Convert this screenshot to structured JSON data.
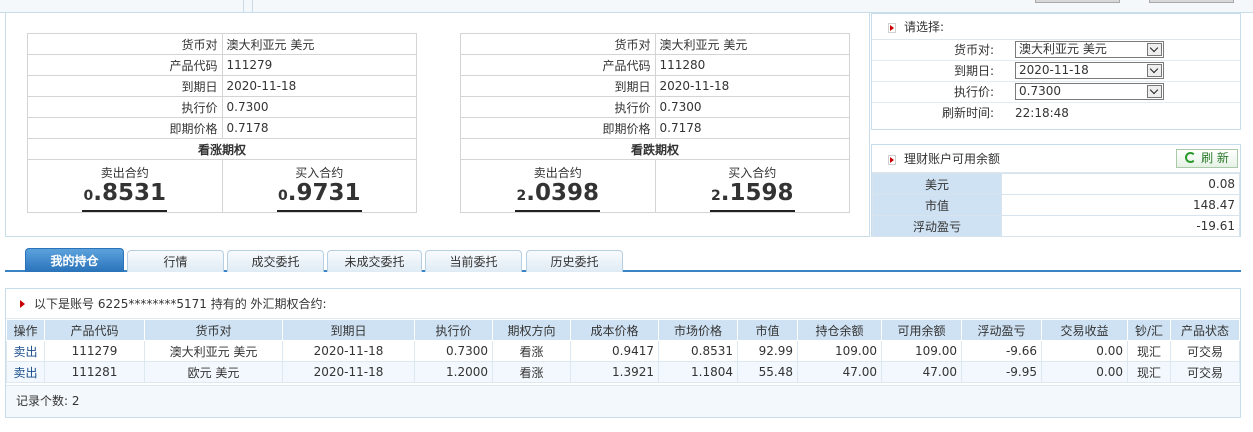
{
  "quotes": [
    {
      "fields": [
        {
          "label": "货币对",
          "value": "澳大利亚元 美元"
        },
        {
          "label": "产品代码",
          "value": "111279"
        },
        {
          "label": "到期日",
          "value": "2020-11-18"
        },
        {
          "label": "执行价",
          "value": "0.7300"
        },
        {
          "label": "即期价格",
          "value": "0.7178"
        }
      ],
      "option_type": "看涨期权",
      "sell_label": "卖出合约",
      "sell_int": "0",
      "sell_dec": ".8531",
      "buy_label": "买入合约",
      "buy_int": "0",
      "buy_dec": ".9731"
    },
    {
      "fields": [
        {
          "label": "货币对",
          "value": "澳大利亚元 美元"
        },
        {
          "label": "产品代码",
          "value": "111280"
        },
        {
          "label": "到期日",
          "value": "2020-11-18"
        },
        {
          "label": "执行价",
          "value": "0.7300"
        },
        {
          "label": "即期价格",
          "value": "0.7178"
        }
      ],
      "option_type": "看跌期权",
      "sell_label": "卖出合约",
      "sell_int": "2",
      "sell_dec": ".0398",
      "buy_label": "买入合约",
      "buy_int": "2",
      "buy_dec": ".1598"
    }
  ],
  "selector": {
    "title": "请选择:",
    "pair_label": "货币对:",
    "pair_value": "澳大利亚元 美元",
    "expiry_label": "到期日:",
    "expiry_value": "2020-11-18",
    "strike_label": "执行价:",
    "strike_value": "0.7300",
    "refresh_label": "刷新时间:",
    "refresh_time": "22:18:48"
  },
  "balance": {
    "title": "理财账户可用余额",
    "refresh_button": "刷 新",
    "rows": [
      {
        "label": "美元",
        "value": "0.08"
      },
      {
        "label": "市值",
        "value": "148.47"
      },
      {
        "label": "浮动盈亏",
        "value": "-19.61"
      }
    ]
  },
  "tabs": [
    "我的持仓",
    "行情",
    "成交委托",
    "未成交委托",
    "当前委托",
    "历史委托"
  ],
  "holdings": {
    "caption": "以下是账号 6225********5171 持有的 外汇期权合约:",
    "columns": [
      "操作",
      "产品代码",
      "货币对",
      "到期日",
      "执行价",
      "期权方向",
      "成本价格",
      "市场价格",
      "市值",
      "持仓余额",
      "可用余额",
      "浮动盈亏",
      "交易收益",
      "钞/汇",
      "产品状态"
    ],
    "rows": [
      [
        "卖出",
        "111279",
        "澳大利亚元 美元",
        "2020-11-18",
        "0.7300",
        "看涨",
        "0.9417",
        "0.8531",
        "92.99",
        "109.00",
        "109.00",
        "-9.66",
        "0.00",
        "现汇",
        "可交易"
      ],
      [
        "卖出",
        "111281",
        "欧元 美元",
        "2020-11-18",
        "1.2000",
        "看涨",
        "1.3921",
        "1.1804",
        "55.48",
        "47.00",
        "47.00",
        "-9.95",
        "0.00",
        "现汇",
        "可交易"
      ]
    ],
    "record_label": "记录个数: ",
    "record_count": "2"
  },
  "colors": {
    "accent": "#2a73ba",
    "header_bg": "#cfe2f3",
    "arrow": "#cc0000"
  }
}
